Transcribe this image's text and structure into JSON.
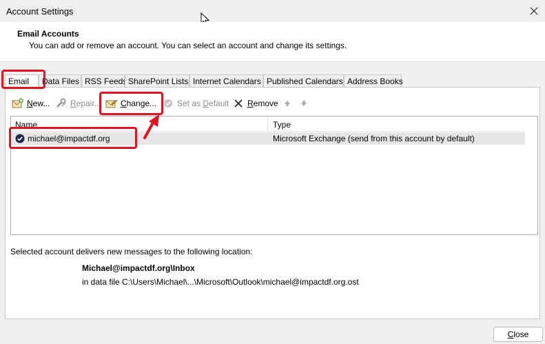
{
  "window": {
    "title": "Account Settings",
    "close_icon": "close-icon"
  },
  "header": {
    "title": "Email Accounts",
    "description": "You can add or remove an account. You can select an account and change its settings."
  },
  "tabs": [
    {
      "label": "Email",
      "active": true
    },
    {
      "label": "Data Files"
    },
    {
      "label": "RSS Feeds"
    },
    {
      "label": "SharePoint Lists"
    },
    {
      "label": "Internet Calendars"
    },
    {
      "label": "Published Calendars"
    },
    {
      "label": "Address Books"
    }
  ],
  "toolbar": {
    "new": {
      "prefix": "",
      "key": "N",
      "suffix": "ew...",
      "icon": "new-account-icon"
    },
    "repair": {
      "prefix": "",
      "key": "R",
      "suffix": "epair...",
      "icon": "wrench-icon"
    },
    "change": {
      "prefix": "",
      "key": "C",
      "suffix": "hange...",
      "icon": "change-account-icon"
    },
    "set_default": {
      "prefix": "Set as ",
      "key": "D",
      "suffix": "efault",
      "icon": "checkmark-icon"
    },
    "remove": {
      "prefix": "",
      "key": "R",
      "suffix": "emove",
      "icon": "x-icon"
    },
    "move_up_icon": "arrow-up-icon",
    "move_down_icon": "arrow-down-icon"
  },
  "accounts": {
    "columns": {
      "name": "Name",
      "type": "Type"
    },
    "rows": [
      {
        "name": "michael@impactdf.org",
        "type": "Microsoft Exchange (send from this account by default)",
        "icon": "default-account-check-icon"
      }
    ]
  },
  "delivery": {
    "label": "Selected account delivers new messages to the following location:",
    "path": "Michael@impactdf.org\\Inbox",
    "file": "in data file C:\\Users\\Michael\\...\\Microsoft\\Outlook\\michael@impactdf.org.ost"
  },
  "footer": {
    "close_prefix": "",
    "close_key": "C",
    "close_suffix": "lose"
  },
  "colors": {
    "highlight": "#e0141e",
    "selected_row": "#e6e6e6",
    "header_bg": "#ffffff"
  }
}
